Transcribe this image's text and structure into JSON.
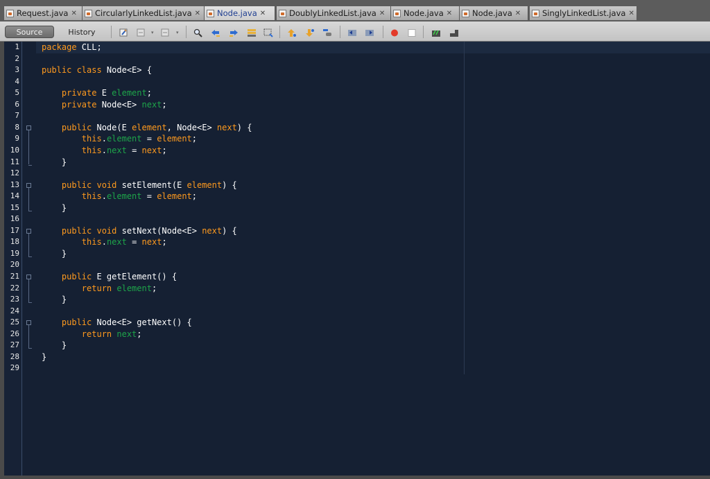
{
  "tabs": [
    {
      "label": "Request.java",
      "active": false
    },
    {
      "label": "CircularlyLinkedList.java",
      "active": false
    },
    {
      "label": "Node.java",
      "active": true
    },
    {
      "label": "DoublyLinkedList.java",
      "active": false
    },
    {
      "label": "Node.java",
      "active": false
    },
    {
      "label": "Node.java",
      "active": false
    },
    {
      "label": "SinglyLinkedList.java",
      "active": false
    }
  ],
  "toolbar": {
    "source_label": "Source",
    "history_label": "History"
  },
  "editor": {
    "line_numbers": [
      "1",
      "2",
      "3",
      "4",
      "5",
      "6",
      "7",
      "8",
      "9",
      "10",
      "11",
      "12",
      "13",
      "14",
      "15",
      "16",
      "17",
      "18",
      "19",
      "20",
      "21",
      "22",
      "23",
      "24",
      "25",
      "26",
      "27",
      "28",
      "29"
    ],
    "lines": [
      {
        "tokens": [
          [
            "k",
            "package "
          ],
          [
            "t",
            "CLL;"
          ]
        ]
      },
      {
        "tokens": []
      },
      {
        "tokens": [
          [
            "k",
            "public class "
          ],
          [
            "t",
            "Node<E> {"
          ]
        ]
      },
      {
        "tokens": []
      },
      {
        "tokens": [
          [
            "t",
            "    "
          ],
          [
            "k",
            "private "
          ],
          [
            "t",
            "E "
          ],
          [
            "f",
            "element"
          ],
          [
            "t",
            ";"
          ]
        ]
      },
      {
        "tokens": [
          [
            "t",
            "    "
          ],
          [
            "k",
            "private "
          ],
          [
            "t",
            "Node<E> "
          ],
          [
            "f",
            "next"
          ],
          [
            "t",
            ";"
          ]
        ]
      },
      {
        "tokens": []
      },
      {
        "tokens": [
          [
            "t",
            "    "
          ],
          [
            "k",
            "public "
          ],
          [
            "t",
            "Node(E "
          ],
          [
            "pm",
            "element"
          ],
          [
            "t",
            ", Node<E> "
          ],
          [
            "pm",
            "next"
          ],
          [
            "t",
            ") {"
          ]
        ]
      },
      {
        "tokens": [
          [
            "t",
            "        "
          ],
          [
            "k",
            "this"
          ],
          [
            "t",
            "."
          ],
          [
            "f",
            "element"
          ],
          [
            "t",
            " = "
          ],
          [
            "pm",
            "element"
          ],
          [
            "t",
            ";"
          ]
        ]
      },
      {
        "tokens": [
          [
            "t",
            "        "
          ],
          [
            "k",
            "this"
          ],
          [
            "t",
            "."
          ],
          [
            "f",
            "next"
          ],
          [
            "t",
            " = "
          ],
          [
            "pm",
            "next"
          ],
          [
            "t",
            ";"
          ]
        ]
      },
      {
        "tokens": [
          [
            "t",
            "    }"
          ]
        ]
      },
      {
        "tokens": []
      },
      {
        "tokens": [
          [
            "t",
            "    "
          ],
          [
            "k",
            "public void "
          ],
          [
            "t",
            "setElement(E "
          ],
          [
            "pm",
            "element"
          ],
          [
            "t",
            ") {"
          ]
        ]
      },
      {
        "tokens": [
          [
            "t",
            "        "
          ],
          [
            "k",
            "this"
          ],
          [
            "t",
            "."
          ],
          [
            "f",
            "element"
          ],
          [
            "t",
            " = "
          ],
          [
            "pm",
            "element"
          ],
          [
            "t",
            ";"
          ]
        ]
      },
      {
        "tokens": [
          [
            "t",
            "    }"
          ]
        ]
      },
      {
        "tokens": []
      },
      {
        "tokens": [
          [
            "t",
            "    "
          ],
          [
            "k",
            "public void "
          ],
          [
            "t",
            "setNext(Node<E> "
          ],
          [
            "pm",
            "next"
          ],
          [
            "t",
            ") {"
          ]
        ]
      },
      {
        "tokens": [
          [
            "t",
            "        "
          ],
          [
            "k",
            "this"
          ],
          [
            "t",
            "."
          ],
          [
            "f",
            "next"
          ],
          [
            "t",
            " = "
          ],
          [
            "pm",
            "next"
          ],
          [
            "t",
            ";"
          ]
        ]
      },
      {
        "tokens": [
          [
            "t",
            "    }"
          ]
        ]
      },
      {
        "tokens": []
      },
      {
        "tokens": [
          [
            "t",
            "    "
          ],
          [
            "k",
            "public "
          ],
          [
            "t",
            "E getElement() {"
          ]
        ]
      },
      {
        "tokens": [
          [
            "t",
            "        "
          ],
          [
            "k",
            "return "
          ],
          [
            "f",
            "element"
          ],
          [
            "t",
            ";"
          ]
        ]
      },
      {
        "tokens": [
          [
            "t",
            "    }"
          ]
        ]
      },
      {
        "tokens": []
      },
      {
        "tokens": [
          [
            "t",
            "    "
          ],
          [
            "k",
            "public "
          ],
          [
            "t",
            "Node<E> getNext() {"
          ]
        ]
      },
      {
        "tokens": [
          [
            "t",
            "        "
          ],
          [
            "k",
            "return "
          ],
          [
            "f",
            "next"
          ],
          [
            "t",
            ";"
          ]
        ]
      },
      {
        "tokens": [
          [
            "t",
            "    }"
          ]
        ]
      },
      {
        "tokens": [
          [
            "t",
            "}"
          ]
        ]
      },
      {
        "tokens": []
      }
    ],
    "fold_lines": [
      8,
      13,
      17,
      21,
      25
    ],
    "colors": {
      "background": "#152033",
      "keyword": "#ff9a1e",
      "field": "#1ea54a",
      "text": "#ffffff"
    }
  },
  "icons": [
    "source-toggle-icon",
    "back-icon",
    "forward-icon",
    "find-icon",
    "find-previous-icon",
    "find-next-icon",
    "toggle-highlight-icon",
    "toggle-rect-select-icon",
    "previous-bookmark-icon",
    "next-bookmark-icon",
    "toggle-bookmark-icon",
    "shift-left-icon",
    "shift-right-icon",
    "start-macro-icon",
    "stop-macro-icon",
    "comment-icon",
    "uncomment-icon"
  ]
}
